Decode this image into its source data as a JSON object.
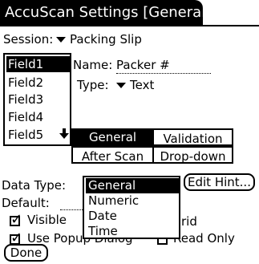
{
  "window": {
    "title": "AccuScan Settings [General]"
  },
  "session": {
    "label": "Session:",
    "value": "Packing Slip"
  },
  "fields": {
    "items": [
      "Field1",
      "Field2",
      "Field3",
      "Field4",
      "Field5"
    ],
    "selected_index": 0
  },
  "field_props": {
    "name_label": "Name:",
    "name_value": "Packer #",
    "type_label": "Type:",
    "type_value": "Text"
  },
  "tabs": {
    "general": "General",
    "validation": "Validation",
    "after_scan": "After Scan",
    "drop_down": "Drop-down",
    "selected": "General"
  },
  "data_type": {
    "label": "Data Type:",
    "value": "General"
  },
  "edit_hint_button": "Edit Hint...",
  "default": {
    "label": "Default:"
  },
  "popup_options": [
    "General",
    "Numeric",
    "Date",
    "Time"
  ],
  "popup_selected_index": 0,
  "visible_checkbox": {
    "label": "Visible",
    "checked": true
  },
  "grid_text": "rid",
  "use_popup_dialog": {
    "label": "Use Popup Dialog",
    "checked": true
  },
  "read_only": {
    "label": "Read Only",
    "checked": false
  },
  "done_button": "Done",
  "colors": {
    "foreground": "#000000",
    "background": "#ffffff"
  }
}
